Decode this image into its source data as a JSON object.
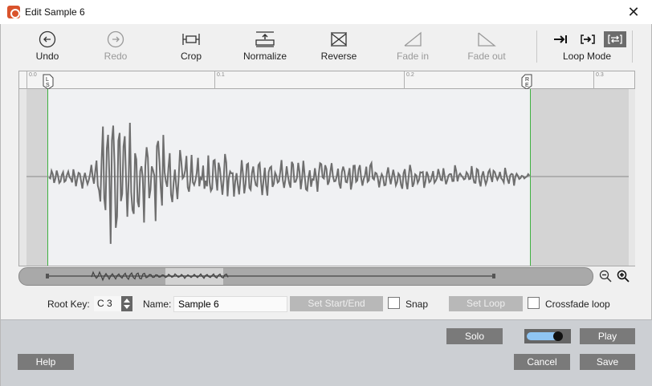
{
  "window": {
    "title": "Edit Sample 6",
    "close_glyph": "✕"
  },
  "toolbar": {
    "undo": "Undo",
    "redo": "Redo",
    "crop": "Crop",
    "normalize": "Normalize",
    "reverse": "Reverse",
    "fade_in": "Fade in",
    "fade_out": "Fade out",
    "loop_mode": "Loop Mode"
  },
  "ruler": {
    "ticks": [
      "0.0",
      "0.1",
      "0.2",
      "0.3"
    ],
    "start_marker": [
      "L",
      "S"
    ],
    "end_marker": [
      "R",
      "E"
    ]
  },
  "controls": {
    "root_key_label": "Root Key:",
    "root_key_value": "C 3",
    "name_label": "Name:",
    "name_value": "Sample 6",
    "set_start_end": "Set Start/End",
    "snap": "Snap",
    "set_loop": "Set Loop",
    "crossfade_loop": "Crossfade loop"
  },
  "footer": {
    "help": "Help",
    "solo": "Solo",
    "play": "Play",
    "cancel": "Cancel",
    "save": "Save"
  },
  "colors": {
    "accent_green": "#3fb140",
    "toggle_blue": "#8fc5f3",
    "waveform": "#6e6e6e"
  }
}
